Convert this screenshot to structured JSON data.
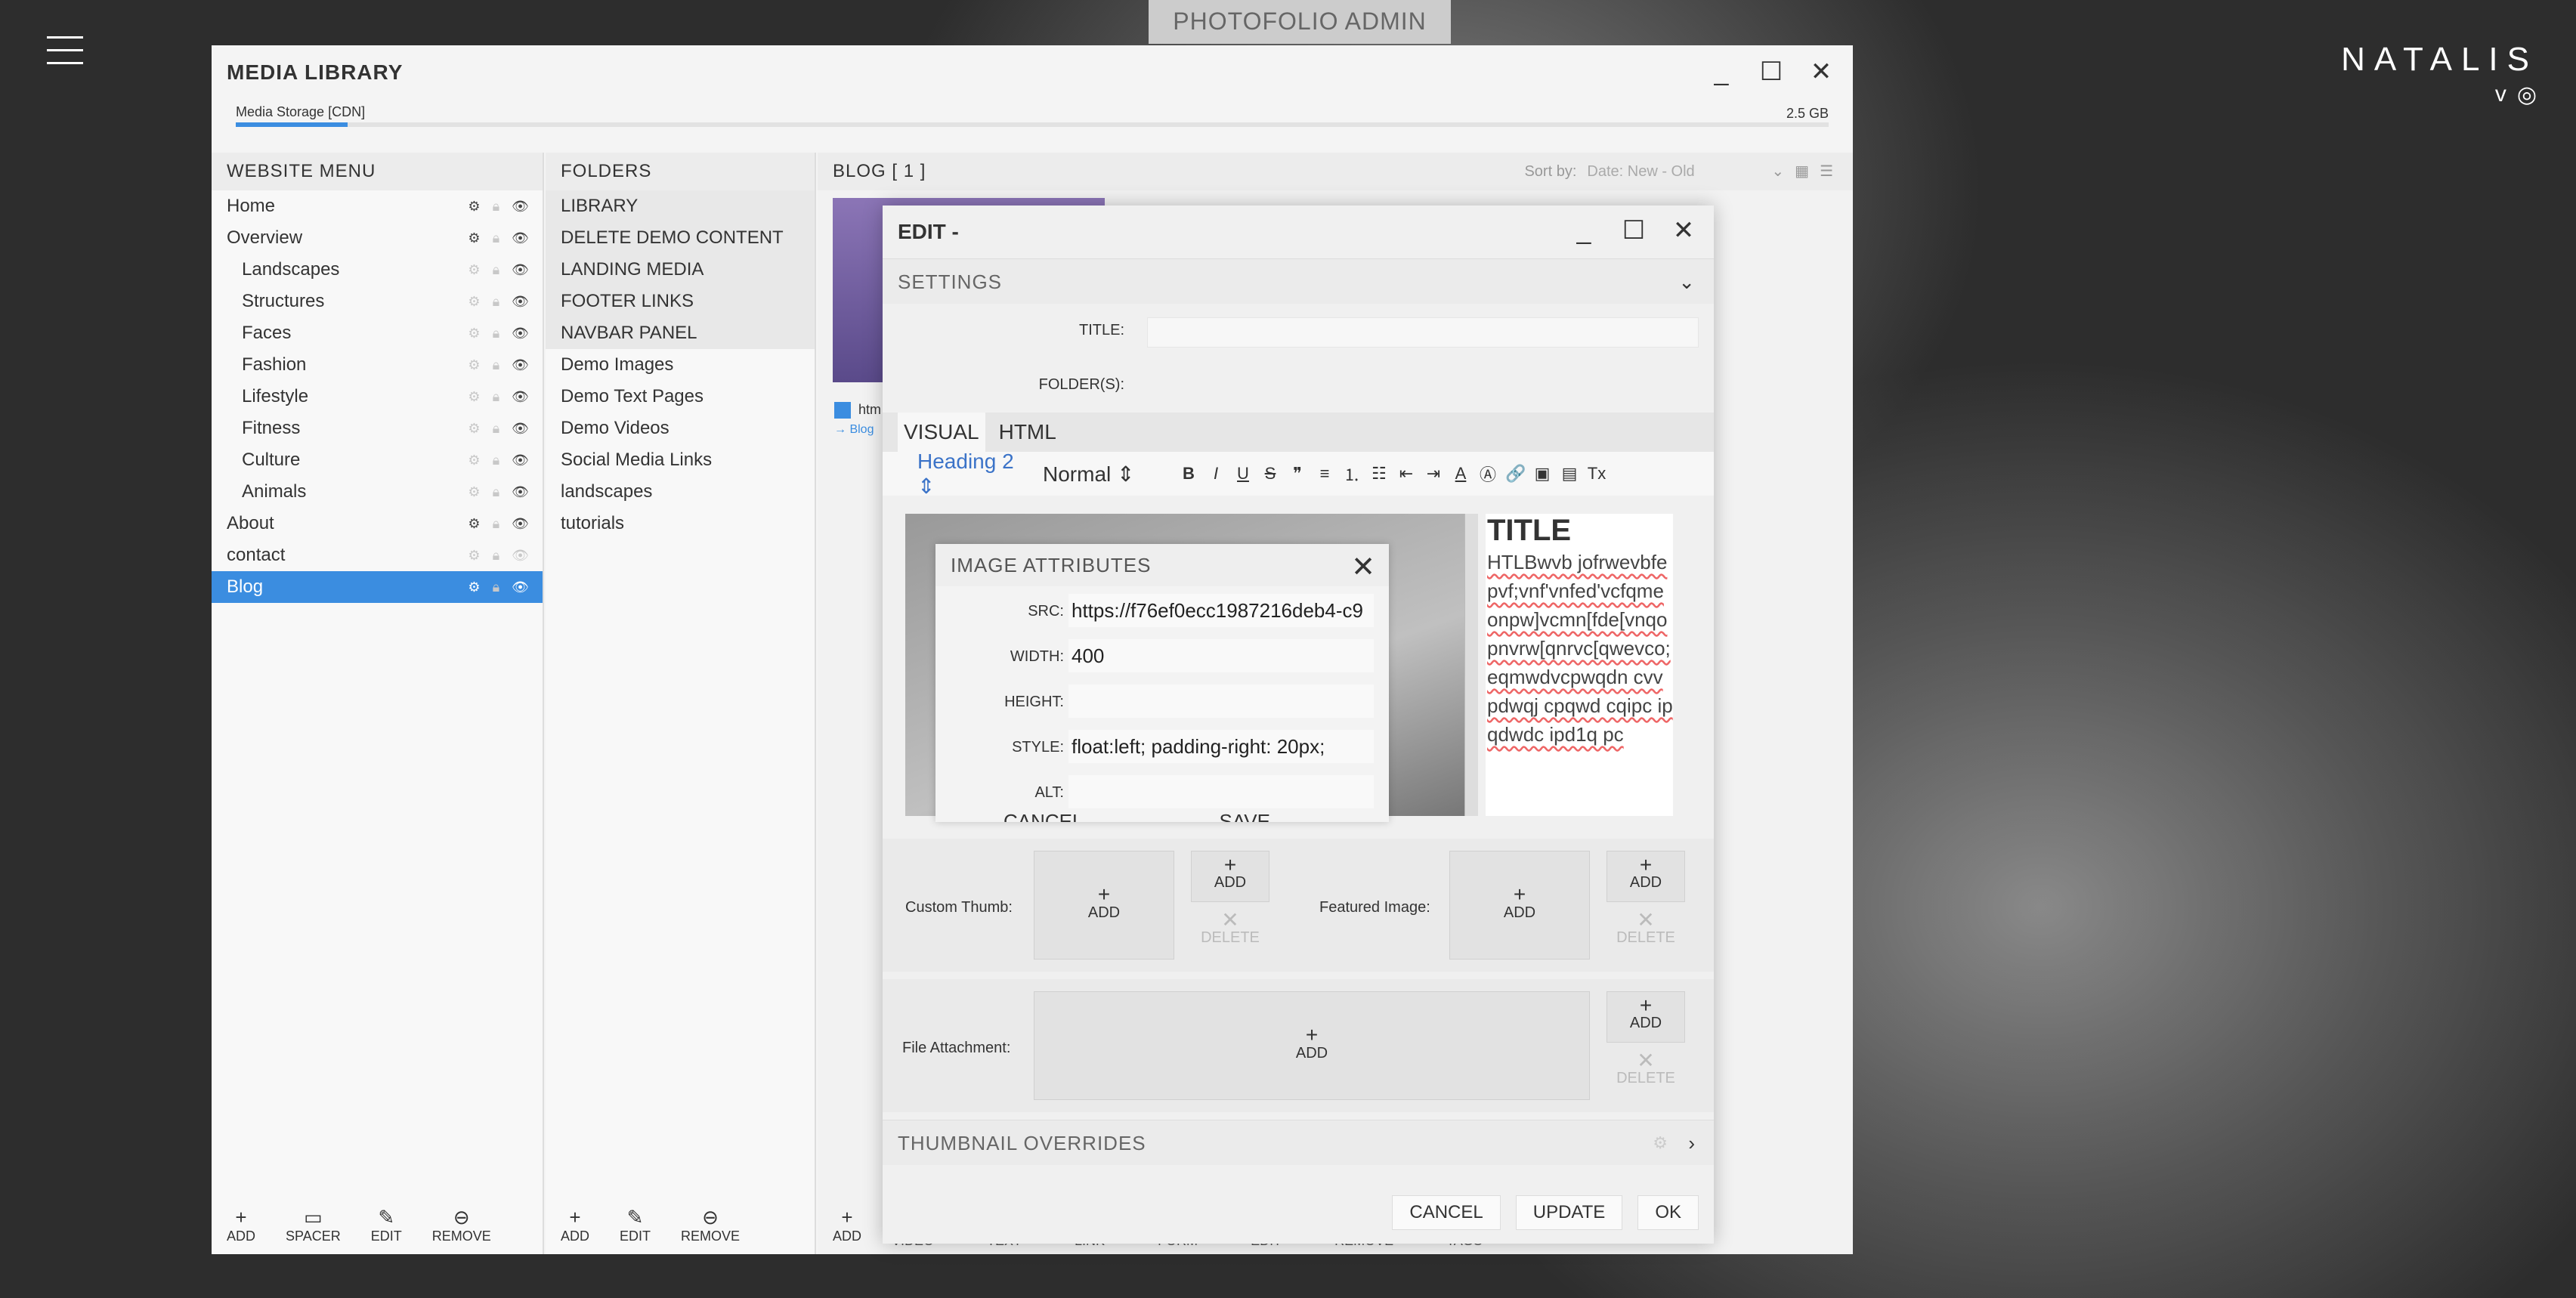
{
  "app": {
    "top_tab": "PHOTOFOLIO ADMIN",
    "brand": "NATALIS",
    "social_vimeo": "v",
    "social_instagram": "◎"
  },
  "media_library": {
    "title": "MEDIA LIBRARY",
    "storage_label": "Media Storage [CDN]",
    "storage_size": "2.5 GB",
    "storage_used_fraction": 0.07
  },
  "website_menu": {
    "header": "WEBSITE MENU",
    "items": [
      {
        "label": "Home",
        "sub": false,
        "gear": true,
        "eye": true
      },
      {
        "label": "Overview",
        "sub": false,
        "gear": true,
        "eye": true
      },
      {
        "label": "Landscapes",
        "sub": true,
        "gear": false,
        "eye": true
      },
      {
        "label": "Structures",
        "sub": true,
        "gear": false,
        "eye": true
      },
      {
        "label": "Faces",
        "sub": true,
        "gear": false,
        "eye": true
      },
      {
        "label": "Fashion",
        "sub": true,
        "gear": false,
        "eye": true
      },
      {
        "label": "Lifestyle",
        "sub": true,
        "gear": false,
        "eye": true
      },
      {
        "label": "Fitness",
        "sub": true,
        "gear": false,
        "eye": true
      },
      {
        "label": "Culture",
        "sub": true,
        "gear": false,
        "eye": true
      },
      {
        "label": "Animals",
        "sub": true,
        "gear": false,
        "eye": true
      },
      {
        "label": "About",
        "sub": false,
        "gear": true,
        "eye": true
      },
      {
        "label": "contact",
        "sub": false,
        "gear": false,
        "eye": false
      },
      {
        "label": "Blog",
        "sub": false,
        "gear": true,
        "eye": true,
        "selected": true
      }
    ],
    "buttons": {
      "add": "ADD",
      "spacer": "SPACER",
      "edit": "EDIT",
      "remove": "REMOVE"
    }
  },
  "folders": {
    "header": "FOLDERS",
    "items": [
      "LIBRARY",
      "DELETE DEMO CONTENT",
      "LANDING MEDIA",
      "FOOTER LINKS",
      "NAVBAR PANEL",
      "Demo Images",
      "Demo Text Pages",
      "Demo Videos",
      "Social Media Links",
      "landscapes",
      "tutorials"
    ],
    "buttons": {
      "add": "ADD",
      "edit": "EDIT",
      "remove": "REMOVE"
    }
  },
  "media": {
    "header": "BLOG  [ 1 ]",
    "sort_label": "Sort by:",
    "sort_value": "Date: New - Old",
    "item_label": "htm",
    "item_path": "→ Blog",
    "bottom_buttons": [
      "ADD",
      "VIDEO",
      "TEXT",
      "LINK",
      "FORM",
      "EDIT",
      "REMOVE",
      "TAGS"
    ]
  },
  "edit": {
    "title": "EDIT -",
    "settings": "SETTINGS",
    "title_label": "TITLE:",
    "folders_label": "FOLDER(S):",
    "tab_visual": "VISUAL",
    "tab_html": "HTML",
    "format_select": "Heading 2",
    "size_select": "Normal",
    "content_heading": "TITLE",
    "content_text": "HTLBwvb jofrwevbfepvf;vnf'vnfed'vcfqmeonpw]vcmn[fde[vnqopnvrw[qnrvc[qwevco;eqmwdvcpwqdn cvvpdwqj cpqwd cqipc ipqdwdc ipd1q pc",
    "custom_thumb_label": "Custom Thumb:",
    "featured_image_label": "Featured Image:",
    "file_attachment_label": "File Attachment:",
    "add": "ADD",
    "delete": "DELETE",
    "thumbnail_overrides": "THUMBNAIL OVERRIDES",
    "cancel": "CANCEL",
    "update": "UPDATE",
    "ok": "OK"
  },
  "image_attributes": {
    "title": "IMAGE ATTRIBUTES",
    "src_label": "SRC:",
    "src": "https://f76ef0ecc1987216deb4-c9",
    "width_label": "WIDTH:",
    "width": "400",
    "height_label": "HEIGHT:",
    "height": "",
    "style_label": "STYLE:",
    "style": "float:left; padding-right: 20px;",
    "alt_label": "ALT:",
    "alt": "",
    "cancel": "CANCEL",
    "save": "SAVE"
  }
}
